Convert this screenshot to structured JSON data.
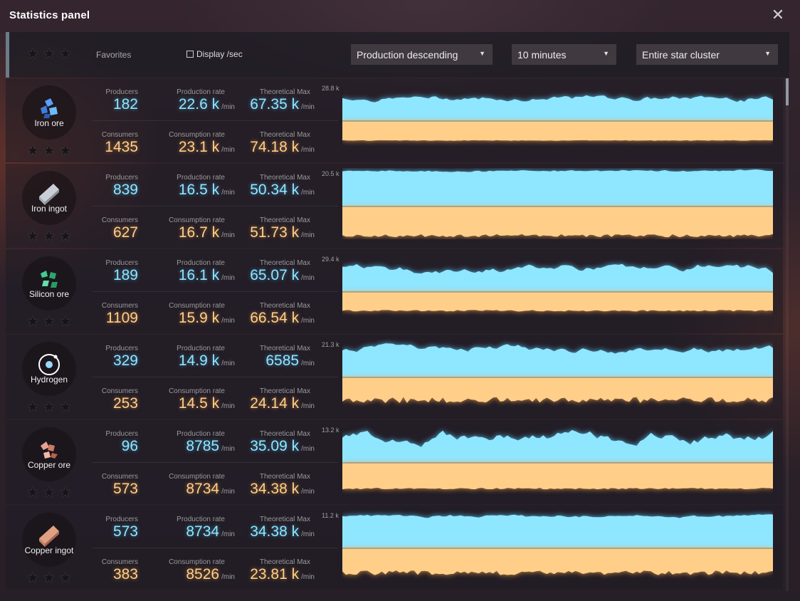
{
  "title": "Statistics panel",
  "filter": {
    "favorites_label": "Favorites",
    "display_sec_label": "Display /sec",
    "sort_value": "Production descending",
    "time_value": "10 minutes",
    "scope_value": "Entire star cluster"
  },
  "labels": {
    "producers": "Producers",
    "production_rate": "Production rate",
    "theoretical_max": "Theoretical Max",
    "consumers": "Consumers",
    "consumption_rate": "Consumption rate",
    "per_min": "/min"
  },
  "items": [
    {
      "name": "Iron ore",
      "icon": "iron-ore-icon",
      "producers": "182",
      "production_rate": "22.6 k",
      "prod_theoretical_max": "67.35 k",
      "consumers": "1435",
      "consumption_rate": "23.1 k",
      "cons_theoretical_max": "74.18 k",
      "chart_max": "28.8 k",
      "prod_level": 0.62,
      "cons_level": 0.62,
      "prod_var": 0.1,
      "cons_var": 0.02
    },
    {
      "name": "Iron ingot",
      "icon": "iron-ingot-icon",
      "producers": "839",
      "production_rate": "16.5 k",
      "prod_theoretical_max": "50.34 k",
      "consumers": "627",
      "consumption_rate": "16.7 k",
      "cons_theoretical_max": "51.73 k",
      "chart_max": "20.5 k",
      "prod_level": 0.96,
      "cons_level": 0.93,
      "prod_var": 0.02,
      "cons_var": 0.1
    },
    {
      "name": "Silicon ore",
      "icon": "silicon-ore-icon",
      "producers": "189",
      "production_rate": "16.1 k",
      "prod_theoretical_max": "65.07 k",
      "consumers": "1109",
      "consumption_rate": "15.9 k",
      "cons_theoretical_max": "66.54 k",
      "chart_max": "29.4 k",
      "prod_level": 0.62,
      "cons_level": 0.6,
      "prod_var": 0.15,
      "cons_var": 0.05
    },
    {
      "name": "Hydrogen",
      "icon": "hydrogen-icon",
      "producers": "329",
      "production_rate": "14.9 k",
      "prod_theoretical_max": "6585",
      "consumers": "253",
      "consumption_rate": "14.5 k",
      "cons_theoretical_max": "24.14 k",
      "chart_max": "21.3 k",
      "prod_level": 0.78,
      "cons_level": 0.72,
      "prod_var": 0.12,
      "cons_var": 0.2
    },
    {
      "name": "Copper ore",
      "icon": "copper-ore-icon",
      "producers": "96",
      "production_rate": "8785",
      "prod_theoretical_max": "35.09 k",
      "consumers": "573",
      "consumption_rate": "8734",
      "cons_theoretical_max": "34.38 k",
      "chart_max": "13.2 k",
      "prod_level": 0.7,
      "cons_level": 0.82,
      "prod_var": 0.22,
      "cons_var": 0.05
    },
    {
      "name": "Copper ingot",
      "icon": "copper-ingot-icon",
      "producers": "573",
      "production_rate": "8734",
      "prod_theoretical_max": "34.38 k",
      "consumers": "383",
      "consumption_rate": "8526",
      "cons_theoretical_max": "23.81 k",
      "chart_max": "11.2 k",
      "prod_level": 0.88,
      "cons_level": 0.78,
      "prod_var": 0.04,
      "cons_var": 0.15
    }
  ],
  "colors": {
    "production": "#8fe6ff",
    "consumption": "#ffcf8a"
  }
}
